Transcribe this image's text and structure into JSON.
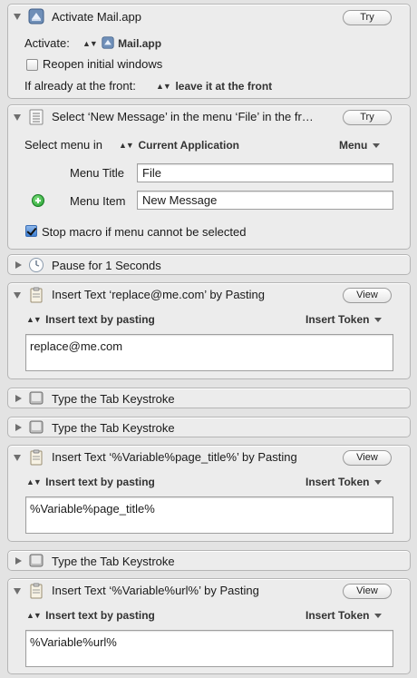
{
  "actions": [
    {
      "title": "Activate Mail.app",
      "button": "Try",
      "activate_label": "Activate:",
      "activate_app": "Mail.app",
      "reopen_label": "Reopen initial windows",
      "reopen_checked": false,
      "front_label": "If already at the front:",
      "front_value": "leave it at the front"
    },
    {
      "title": "Select ‘New Message’ in the menu ‘File’ in the fr…",
      "button": "Try",
      "select_menu_label": "Select menu in",
      "select_menu_value": "Current Application",
      "menu_dropdown": "Menu",
      "menu_title_label": "Menu Title",
      "menu_title_value": "File",
      "menu_item_label": "Menu Item",
      "menu_item_value": "New Message",
      "stop_label": "Stop macro if menu cannot be selected",
      "stop_checked": true
    },
    {
      "title": "Pause for 1 Seconds"
    },
    {
      "title": "Insert Text ‘replace@me.com’ by Pasting",
      "button": "View",
      "mode": "Insert text by pasting",
      "token": "Insert Token",
      "text": "replace@me.com"
    },
    {
      "title": "Type the Tab Keystroke"
    },
    {
      "title": "Type the Tab Keystroke"
    },
    {
      "title": "Insert Text ‘%Variable%page_title%’ by Pasting",
      "button": "View",
      "mode": "Insert text by pasting",
      "token": "Insert Token",
      "text": "%Variable%page_title%"
    },
    {
      "title": "Type the Tab Keystroke"
    },
    {
      "title": "Insert Text ‘%Variable%url%’ by Pasting",
      "button": "View",
      "mode": "Insert text by pasting",
      "token": "Insert Token",
      "text": "%Variable%url%"
    }
  ]
}
